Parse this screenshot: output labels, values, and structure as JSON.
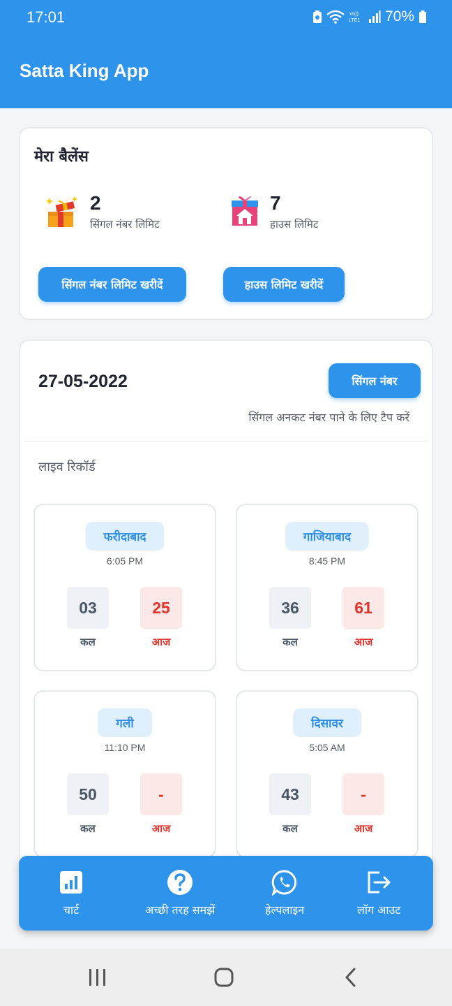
{
  "status_bar": {
    "time": "17:01",
    "battery": "70%"
  },
  "app": {
    "title": "Satta King App"
  },
  "balance": {
    "title": "मेरा बैलेंस",
    "single_limit": {
      "value": "2",
      "label": "सिंगल नंबर लिमिट",
      "icon": "gift-icon"
    },
    "house_limit": {
      "value": "7",
      "label": "हाउस लिमिट",
      "icon": "gift-house-icon"
    },
    "buy_single_label": "सिंगल नंबर लिमिट खरीदें",
    "buy_house_label": "हाउस लिमिट खरीदें"
  },
  "live": {
    "date": "27-05-2022",
    "single_button": "सिंगल नंबर",
    "hint": "सिंगल अनकट नंबर पाने के लिए टैप करें",
    "section_label": "लाइव रिकॉर्ड",
    "yesterday_label": "कल",
    "today_label": "आज",
    "markets": [
      {
        "name": "फरीदाबाद",
        "time": "6:05 PM",
        "yesterday": "03",
        "today": "25"
      },
      {
        "name": "गाजियाबाद",
        "time": "8:45 PM",
        "yesterday": "36",
        "today": "61"
      },
      {
        "name": "गली",
        "time": "11:10 PM",
        "yesterday": "50",
        "today": "-"
      },
      {
        "name": "दिसावर",
        "time": "5:05 AM",
        "yesterday": "43",
        "today": "-"
      }
    ]
  },
  "bottom_nav": [
    {
      "label": "चार्ट",
      "icon": "chart-icon"
    },
    {
      "label": "अच्छी तरह समझें",
      "icon": "help-icon"
    },
    {
      "label": "हेल्पलाइन",
      "icon": "whatsapp-icon"
    },
    {
      "label": "लॉग आउट",
      "icon": "logout-icon"
    }
  ],
  "colors": {
    "primary": "#2e93ea",
    "danger": "#e0332b"
  }
}
